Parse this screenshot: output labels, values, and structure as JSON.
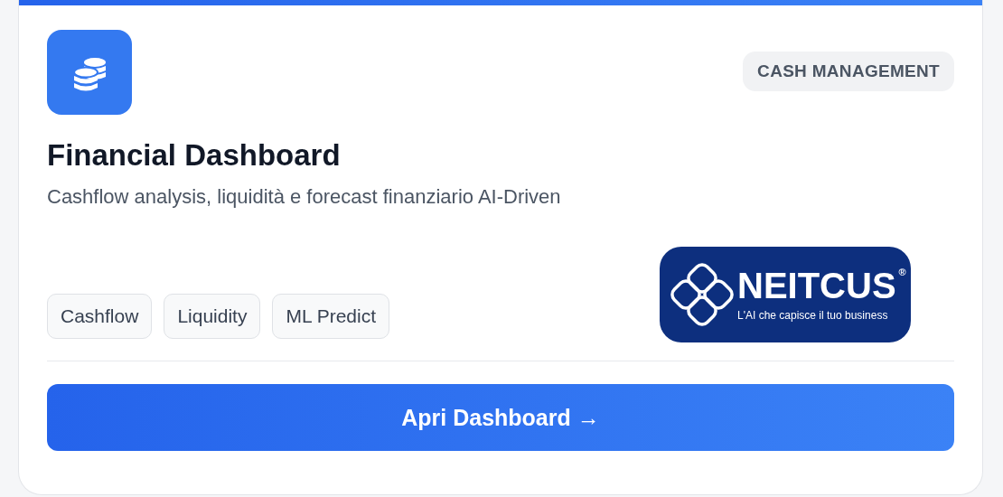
{
  "card": {
    "category": "CASH MANAGEMENT",
    "title": "Financial Dashboard",
    "description": "Cashflow analysis, liquidità e forecast finanziario AI-Driven",
    "tags": [
      "Cashflow",
      "Liquidity",
      "ML Predict"
    ],
    "logo": {
      "name": "NEITCUS",
      "registered": "®",
      "tagline": "L'AI che capisce il tuo business"
    },
    "button": {
      "label": "Apri Dashboard",
      "arrow": "→"
    }
  }
}
